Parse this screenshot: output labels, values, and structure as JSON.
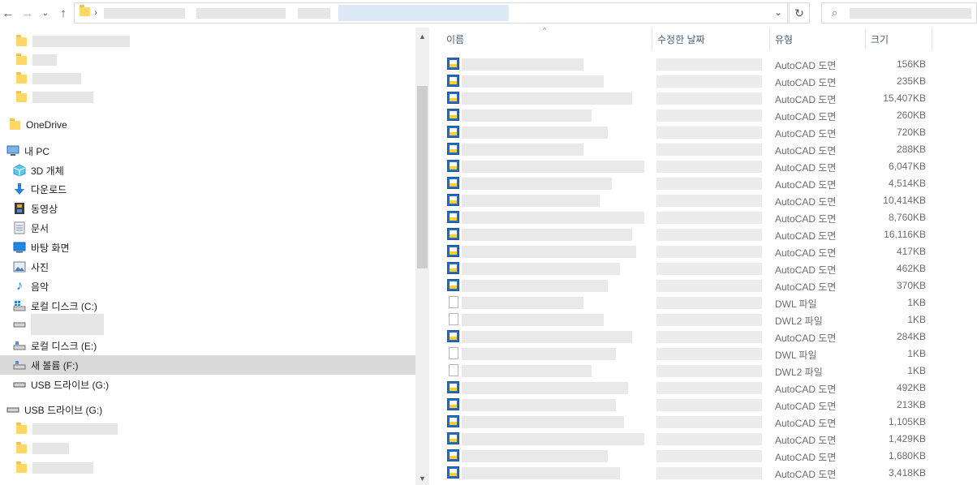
{
  "search": {
    "placeholder": ""
  },
  "nav": {
    "onedrive": "OneDrive",
    "this_pc": "내 PC",
    "objects3d": "3D 개체",
    "downloads": "다운로드",
    "videos": "동영상",
    "documents": "문서",
    "desktop": "바탕 화면",
    "pictures": "사진",
    "music": "음악",
    "drive_c": "로컬 디스크 (C:)",
    "drive_e": "로컬 디스크 (E:)",
    "drive_f": "새 볼륨 (F:)",
    "drive_g": "USB 드라이브 (G:)",
    "drive_g_root": "USB 드라이브 (G:)"
  },
  "columns": {
    "name": "이름",
    "date": "수정한 날짜",
    "type": "유형",
    "size": "크기"
  },
  "files": [
    {
      "type": "AutoCAD 도면",
      "size": "156KB",
      "icon": "dwg-icon"
    },
    {
      "type": "AutoCAD 도면",
      "size": "235KB",
      "icon": "dwg-icon"
    },
    {
      "type": "AutoCAD 도면",
      "size": "15,407KB",
      "icon": "dwg-icon"
    },
    {
      "type": "AutoCAD 도면",
      "size": "260KB",
      "icon": "dwg-icon"
    },
    {
      "type": "AutoCAD 도면",
      "size": "720KB",
      "icon": "dwg-icon"
    },
    {
      "type": "AutoCAD 도면",
      "size": "288KB",
      "icon": "dwg-icon"
    },
    {
      "type": "AutoCAD 도면",
      "size": "6,047KB",
      "icon": "dwg-icon"
    },
    {
      "type": "AutoCAD 도면",
      "size": "4,514KB",
      "icon": "dwg-icon"
    },
    {
      "type": "AutoCAD 도면",
      "size": "10,414KB",
      "icon": "dwg-icon"
    },
    {
      "type": "AutoCAD 도면",
      "size": "8,760KB",
      "icon": "dwg-icon"
    },
    {
      "type": "AutoCAD 도면",
      "size": "16,116KB",
      "icon": "dwg-icon"
    },
    {
      "type": "AutoCAD 도면",
      "size": "417KB",
      "icon": "dwg-icon"
    },
    {
      "type": "AutoCAD 도면",
      "size": "462KB",
      "icon": "dwg-icon"
    },
    {
      "type": "AutoCAD 도면",
      "size": "370KB",
      "icon": "dwg-icon"
    },
    {
      "type": "DWL 파일",
      "size": "1KB",
      "icon": "blank-file-icon"
    },
    {
      "type": "DWL2 파일",
      "size": "1KB",
      "icon": "blank-file-icon"
    },
    {
      "type": "AutoCAD 도면",
      "size": "284KB",
      "icon": "dwg-icon"
    },
    {
      "type": "DWL 파일",
      "size": "1KB",
      "icon": "blank-file-icon"
    },
    {
      "type": "DWL2 파일",
      "size": "1KB",
      "icon": "blank-file-icon"
    },
    {
      "type": "AutoCAD 도면",
      "size": "492KB",
      "icon": "dwg-icon"
    },
    {
      "type": "AutoCAD 도면",
      "size": "213KB",
      "icon": "dwg-icon"
    },
    {
      "type": "AutoCAD 도면",
      "size": "1,105KB",
      "icon": "dwg-icon"
    },
    {
      "type": "AutoCAD 도면",
      "size": "1,429KB",
      "icon": "dwg-icon"
    },
    {
      "type": "AutoCAD 도면",
      "size": "1,680KB",
      "icon": "dwg-icon"
    },
    {
      "type": "AutoCAD 도면",
      "size": "3,418KB",
      "icon": "dwg-icon"
    }
  ]
}
